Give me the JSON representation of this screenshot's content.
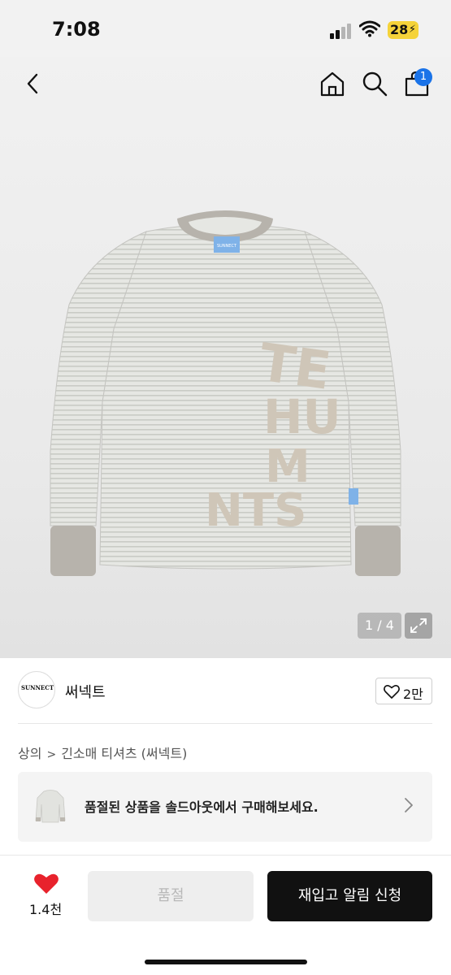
{
  "status_bar": {
    "time": "7:08",
    "battery": "28",
    "battery_icon": "charging-bolt-icon"
  },
  "header": {
    "back_icon": "chevron-left-icon",
    "home_icon": "home-icon",
    "search_icon": "search-icon",
    "cart_icon": "shopping-bag-icon",
    "cart_badge": "1"
  },
  "gallery": {
    "counter": "1 / 4",
    "expand_icon": "expand-arrows-icon",
    "product_print": [
      "TE",
      "HU",
      "M",
      "NTS"
    ],
    "tag_text": "SUNNECT"
  },
  "brand": {
    "logo_text": "SUNNECT",
    "name": "써넥트",
    "like_count": "2만"
  },
  "breadcrumb": {
    "items": [
      "상의",
      "긴소매 티셔츠 (써넥트)"
    ]
  },
  "soldout_banner": {
    "text": "품절된 상품을 솔드아웃에서 구매해보세요.",
    "chevron_icon": "chevron-right-icon"
  },
  "bottom_bar": {
    "wish_count": "1.4천",
    "soldout_label": "품절",
    "restock_label": "재입고 알림 신청"
  },
  "colors": {
    "accent_blue": "#1a73e8",
    "heart_red": "#e8222c",
    "primary_button": "#111111"
  }
}
